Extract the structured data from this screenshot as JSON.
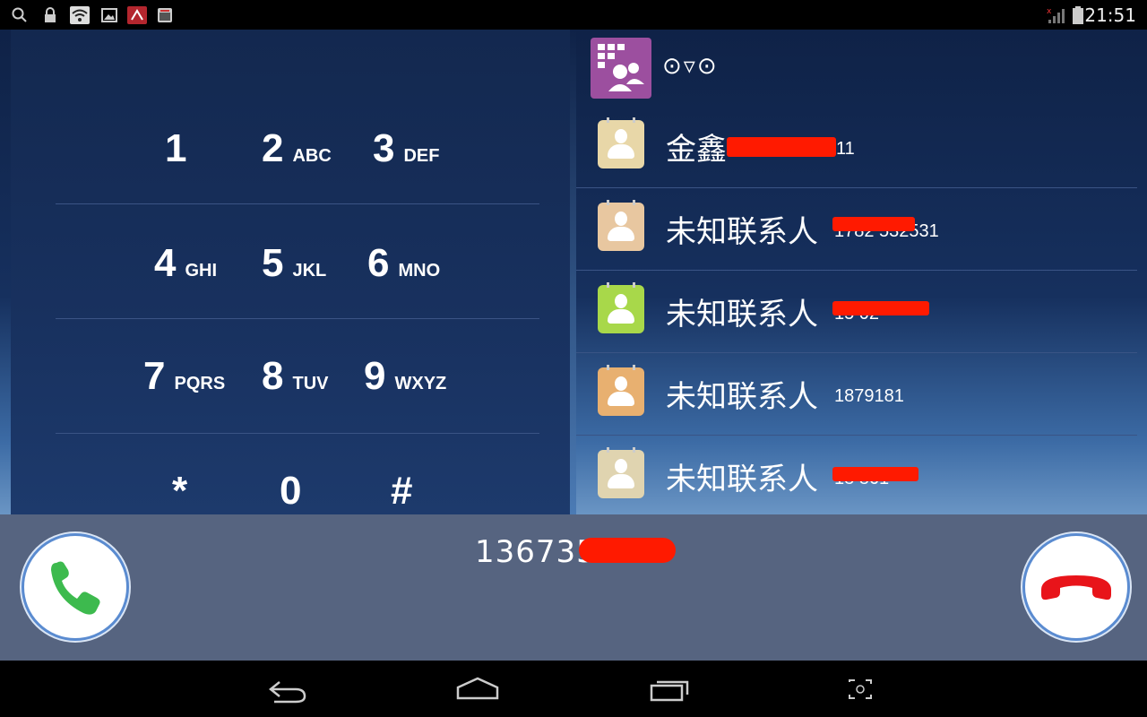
{
  "status_bar": {
    "time": "21:51",
    "icons_left": [
      "search-icon",
      "lock-icon",
      "wifi-icon",
      "image-icon",
      "app-badge-icon",
      "calendar-icon"
    ],
    "icons_right": [
      "signal-icon",
      "battery-icon"
    ]
  },
  "keypad": {
    "keys": [
      {
        "num": "1",
        "letters": ""
      },
      {
        "num": "2",
        "letters": "ABC"
      },
      {
        "num": "3",
        "letters": "DEF"
      },
      {
        "num": "4",
        "letters": "GHI"
      },
      {
        "num": "5",
        "letters": "JKL"
      },
      {
        "num": "6",
        "letters": "MNO"
      },
      {
        "num": "7",
        "letters": "PQRS"
      },
      {
        "num": "8",
        "letters": "TUV"
      },
      {
        "num": "9",
        "letters": "WXYZ"
      },
      {
        "num": "*",
        "letters": ""
      },
      {
        "num": "0",
        "letters": ""
      },
      {
        "num": "#",
        "letters": ""
      }
    ]
  },
  "contacts_panel": {
    "app_icon": "contacts-keypad-icon",
    "filter_label": "⊙▿⊙",
    "items": [
      {
        "name": "金鑫",
        "number": "11",
        "avatar_color": "#e8d7a8"
      },
      {
        "name": "未知联系人",
        "number": "1782 532531",
        "avatar_color": "#e8c7a0"
      },
      {
        "name": "未知联系人",
        "number": "15 02",
        "avatar_color": "#a8d84a"
      },
      {
        "name": "未知联系人",
        "number": "1879181",
        "avatar_color": "#e8b070"
      },
      {
        "name": "未知联系人",
        "number": "18 861",
        "avatar_color": "#e0d4b0"
      }
    ]
  },
  "call_bar": {
    "dialed_number": "136735",
    "call_button_icon": "phone-call-icon",
    "hangup_button_icon": "phone-hangup-icon",
    "call_color": "#3dba4e",
    "hangup_color": "#e8141a"
  },
  "nav_bar": {
    "buttons": [
      "back-icon",
      "home-icon",
      "recent-apps-icon",
      "screenshot-icon"
    ]
  }
}
